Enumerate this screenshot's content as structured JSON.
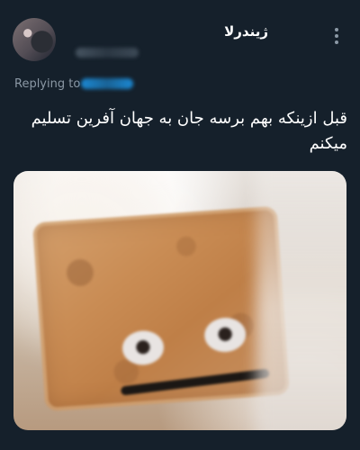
{
  "user": {
    "display_name": "ژیندرلا"
  },
  "reply": {
    "label": "Replying to"
  },
  "tweet": {
    "text": "قبل ازینکه بهم برسه جان به جهان آفرین تسلیم میکنم"
  },
  "icons": {
    "more": "more-vertical-icon"
  },
  "colors": {
    "background": "#15202b",
    "muted_text": "#8b98a5",
    "link": "#1d9bf0"
  }
}
